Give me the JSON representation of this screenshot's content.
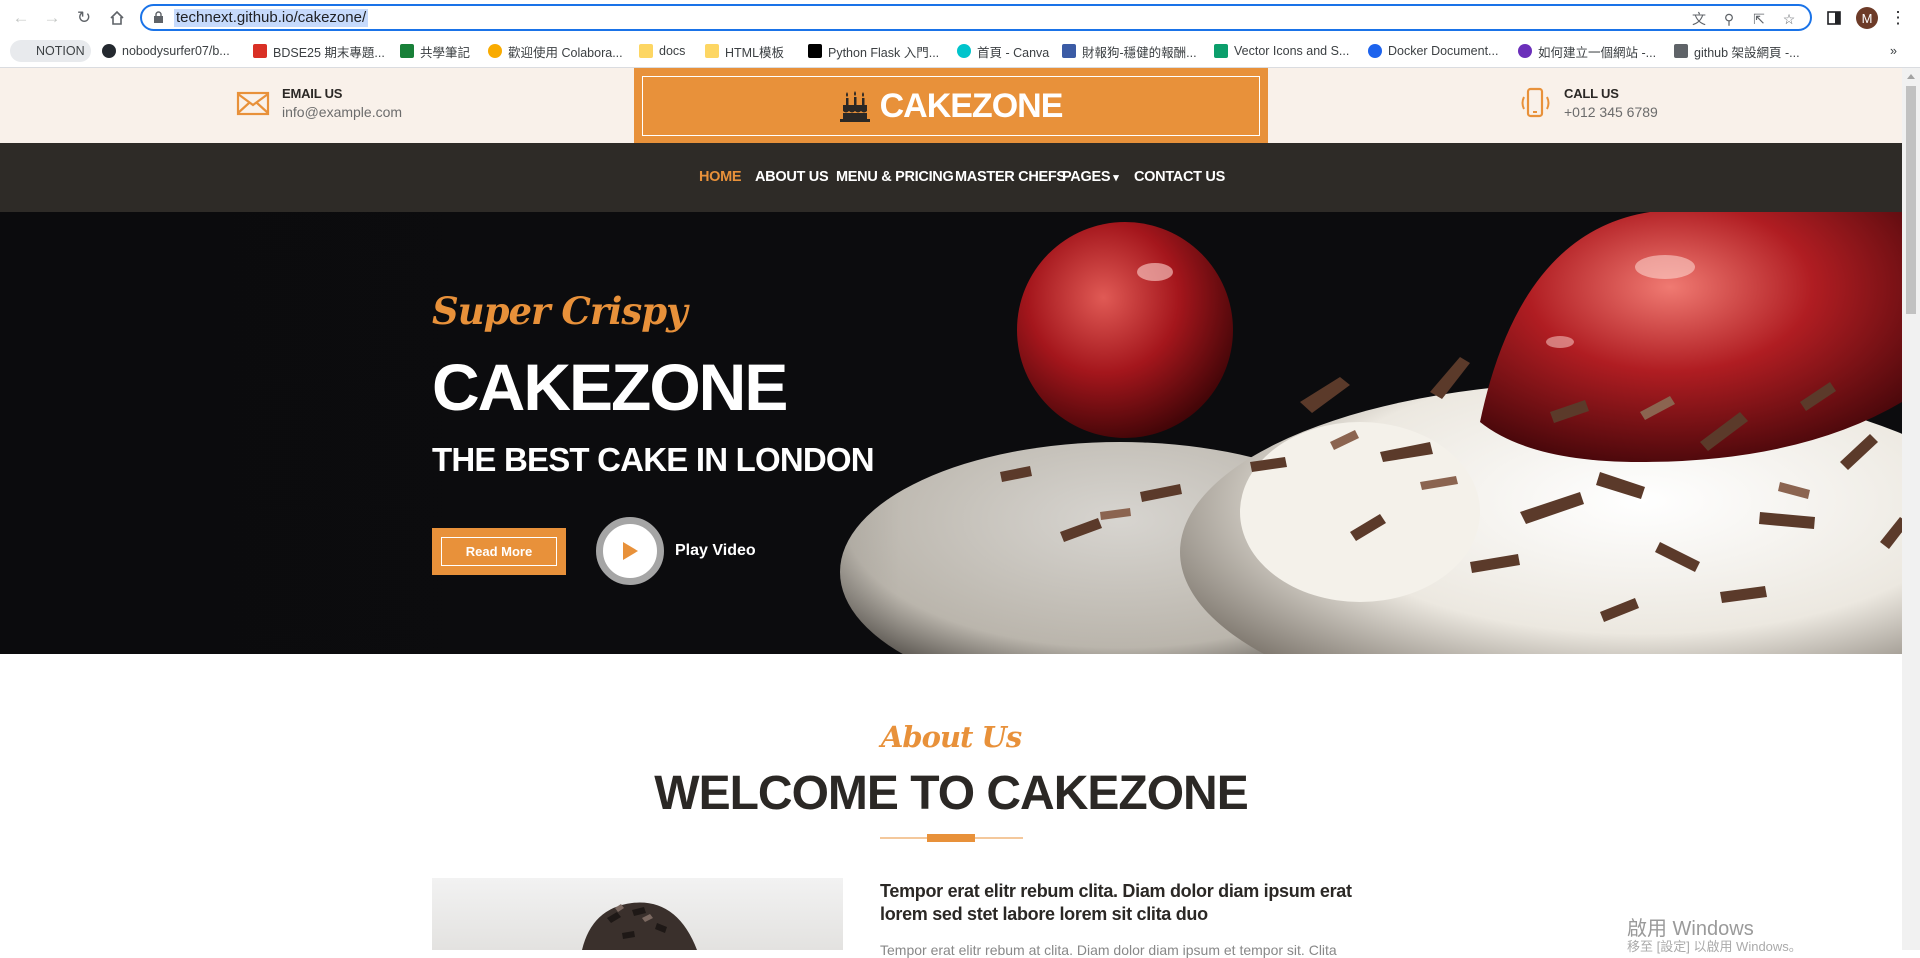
{
  "browser": {
    "url": "technext.github.io/cakezone/",
    "profile_initial": "M",
    "bookmarks": [
      {
        "label": "NOTION",
        "icon": "notion-icon",
        "color": "#e8eaed"
      },
      {
        "label": "nobodysurfer07/b...",
        "icon": "github-icon",
        "color": "#24292f"
      },
      {
        "label": "BDSE25 期末專題...",
        "icon": "hundred-icon",
        "color": "#d93025"
      },
      {
        "label": "共學筆記",
        "icon": "sheets-icon",
        "color": "#188038"
      },
      {
        "label": "歡迎使用 Colabora...",
        "icon": "colab-icon",
        "color": "#f9ab00"
      },
      {
        "label": "docs",
        "icon": "folder-icon",
        "color": "#fdd663"
      },
      {
        "label": "HTML模板",
        "icon": "folder-icon",
        "color": "#fdd663"
      },
      {
        "label": "Python Flask 入門...",
        "icon": "dev-icon",
        "color": "#000000"
      },
      {
        "label": "首頁 - Canva",
        "icon": "canva-icon",
        "color": "#00c4cc"
      },
      {
        "label": "財報狗-穩健的報酬...",
        "icon": "dog-icon",
        "color": "#3b5ba5"
      },
      {
        "label": "Vector Icons and S...",
        "icon": "vector-icon",
        "color": "#0b9e6b"
      },
      {
        "label": "Docker Document...",
        "icon": "docker-icon",
        "color": "#1d63ed"
      },
      {
        "label": "如何建立一個網站 -...",
        "icon": "s-icon",
        "color": "#6b2fba"
      },
      {
        "label": "github 架設網頁 -...",
        "icon": "doc-icon",
        "color": "#5f6368"
      }
    ]
  },
  "site": {
    "email_label": "EMAIL US",
    "email_value": "info@example.com",
    "logo": "CAKEZONE",
    "call_label": "CALL US",
    "call_value": "+012 345 6789",
    "accent": "#e8913a",
    "nav": [
      {
        "label": "HOME",
        "active": true
      },
      {
        "label": "ABOUT US",
        "active": false
      },
      {
        "label": "MENU & PRICING",
        "active": false
      },
      {
        "label": "MASTER CHEFS",
        "active": false
      },
      {
        "label": "PAGES",
        "active": false
      },
      {
        "label": "CONTACT US",
        "active": false
      }
    ]
  },
  "hero": {
    "subtitle": "Super Crispy",
    "title": "CAKEZONE",
    "tagline": "THE BEST CAKE IN LONDON",
    "read_more": "Read More",
    "play_video": "Play Video"
  },
  "about": {
    "subtitle": "About Us",
    "title": "WELCOME TO CAKEZONE",
    "lead": "Tempor erat elitr rebum clita. Diam dolor diam ipsum erat lorem sed stet labore lorem sit clita duo",
    "body": "Tempor erat elitr rebum at clita. Diam dolor diam ipsum et tempor sit. Clita"
  },
  "os": {
    "watermark_title": "啟用 Windows",
    "watermark_sub": "移至 [設定] 以啟用 Windows。"
  }
}
